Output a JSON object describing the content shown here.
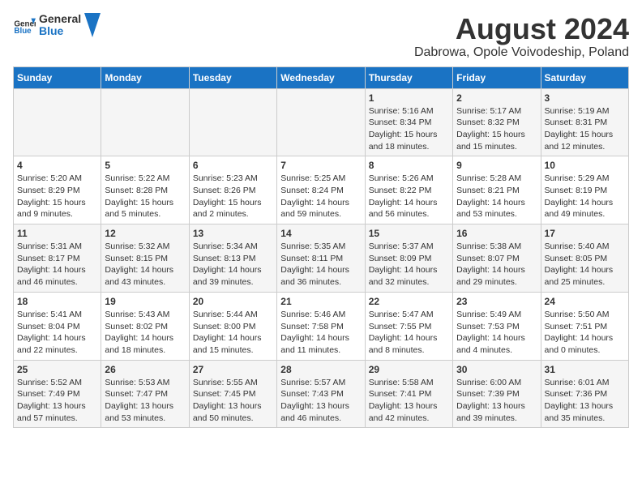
{
  "header": {
    "logo_general": "General",
    "logo_blue": "Blue",
    "main_title": "August 2024",
    "subtitle": "Dabrowa, Opole Voivodeship, Poland"
  },
  "calendar": {
    "days_of_week": [
      "Sunday",
      "Monday",
      "Tuesday",
      "Wednesday",
      "Thursday",
      "Friday",
      "Saturday"
    ],
    "weeks": [
      [
        {
          "day": "",
          "info": ""
        },
        {
          "day": "",
          "info": ""
        },
        {
          "day": "",
          "info": ""
        },
        {
          "day": "",
          "info": ""
        },
        {
          "day": "1",
          "info": "Sunrise: 5:16 AM\nSunset: 8:34 PM\nDaylight: 15 hours and 18 minutes."
        },
        {
          "day": "2",
          "info": "Sunrise: 5:17 AM\nSunset: 8:32 PM\nDaylight: 15 hours and 15 minutes."
        },
        {
          "day": "3",
          "info": "Sunrise: 5:19 AM\nSunset: 8:31 PM\nDaylight: 15 hours and 12 minutes."
        }
      ],
      [
        {
          "day": "4",
          "info": "Sunrise: 5:20 AM\nSunset: 8:29 PM\nDaylight: 15 hours and 9 minutes."
        },
        {
          "day": "5",
          "info": "Sunrise: 5:22 AM\nSunset: 8:28 PM\nDaylight: 15 hours and 5 minutes."
        },
        {
          "day": "6",
          "info": "Sunrise: 5:23 AM\nSunset: 8:26 PM\nDaylight: 15 hours and 2 minutes."
        },
        {
          "day": "7",
          "info": "Sunrise: 5:25 AM\nSunset: 8:24 PM\nDaylight: 14 hours and 59 minutes."
        },
        {
          "day": "8",
          "info": "Sunrise: 5:26 AM\nSunset: 8:22 PM\nDaylight: 14 hours and 56 minutes."
        },
        {
          "day": "9",
          "info": "Sunrise: 5:28 AM\nSunset: 8:21 PM\nDaylight: 14 hours and 53 minutes."
        },
        {
          "day": "10",
          "info": "Sunrise: 5:29 AM\nSunset: 8:19 PM\nDaylight: 14 hours and 49 minutes."
        }
      ],
      [
        {
          "day": "11",
          "info": "Sunrise: 5:31 AM\nSunset: 8:17 PM\nDaylight: 14 hours and 46 minutes."
        },
        {
          "day": "12",
          "info": "Sunrise: 5:32 AM\nSunset: 8:15 PM\nDaylight: 14 hours and 43 minutes."
        },
        {
          "day": "13",
          "info": "Sunrise: 5:34 AM\nSunset: 8:13 PM\nDaylight: 14 hours and 39 minutes."
        },
        {
          "day": "14",
          "info": "Sunrise: 5:35 AM\nSunset: 8:11 PM\nDaylight: 14 hours and 36 minutes."
        },
        {
          "day": "15",
          "info": "Sunrise: 5:37 AM\nSunset: 8:09 PM\nDaylight: 14 hours and 32 minutes."
        },
        {
          "day": "16",
          "info": "Sunrise: 5:38 AM\nSunset: 8:07 PM\nDaylight: 14 hours and 29 minutes."
        },
        {
          "day": "17",
          "info": "Sunrise: 5:40 AM\nSunset: 8:05 PM\nDaylight: 14 hours and 25 minutes."
        }
      ],
      [
        {
          "day": "18",
          "info": "Sunrise: 5:41 AM\nSunset: 8:04 PM\nDaylight: 14 hours and 22 minutes."
        },
        {
          "day": "19",
          "info": "Sunrise: 5:43 AM\nSunset: 8:02 PM\nDaylight: 14 hours and 18 minutes."
        },
        {
          "day": "20",
          "info": "Sunrise: 5:44 AM\nSunset: 8:00 PM\nDaylight: 14 hours and 15 minutes."
        },
        {
          "day": "21",
          "info": "Sunrise: 5:46 AM\nSunset: 7:58 PM\nDaylight: 14 hours and 11 minutes."
        },
        {
          "day": "22",
          "info": "Sunrise: 5:47 AM\nSunset: 7:55 PM\nDaylight: 14 hours and 8 minutes."
        },
        {
          "day": "23",
          "info": "Sunrise: 5:49 AM\nSunset: 7:53 PM\nDaylight: 14 hours and 4 minutes."
        },
        {
          "day": "24",
          "info": "Sunrise: 5:50 AM\nSunset: 7:51 PM\nDaylight: 14 hours and 0 minutes."
        }
      ],
      [
        {
          "day": "25",
          "info": "Sunrise: 5:52 AM\nSunset: 7:49 PM\nDaylight: 13 hours and 57 minutes."
        },
        {
          "day": "26",
          "info": "Sunrise: 5:53 AM\nSunset: 7:47 PM\nDaylight: 13 hours and 53 minutes."
        },
        {
          "day": "27",
          "info": "Sunrise: 5:55 AM\nSunset: 7:45 PM\nDaylight: 13 hours and 50 minutes."
        },
        {
          "day": "28",
          "info": "Sunrise: 5:57 AM\nSunset: 7:43 PM\nDaylight: 13 hours and 46 minutes."
        },
        {
          "day": "29",
          "info": "Sunrise: 5:58 AM\nSunset: 7:41 PM\nDaylight: 13 hours and 42 minutes."
        },
        {
          "day": "30",
          "info": "Sunrise: 6:00 AM\nSunset: 7:39 PM\nDaylight: 13 hours and 39 minutes."
        },
        {
          "day": "31",
          "info": "Sunrise: 6:01 AM\nSunset: 7:36 PM\nDaylight: 13 hours and 35 minutes."
        }
      ]
    ]
  }
}
